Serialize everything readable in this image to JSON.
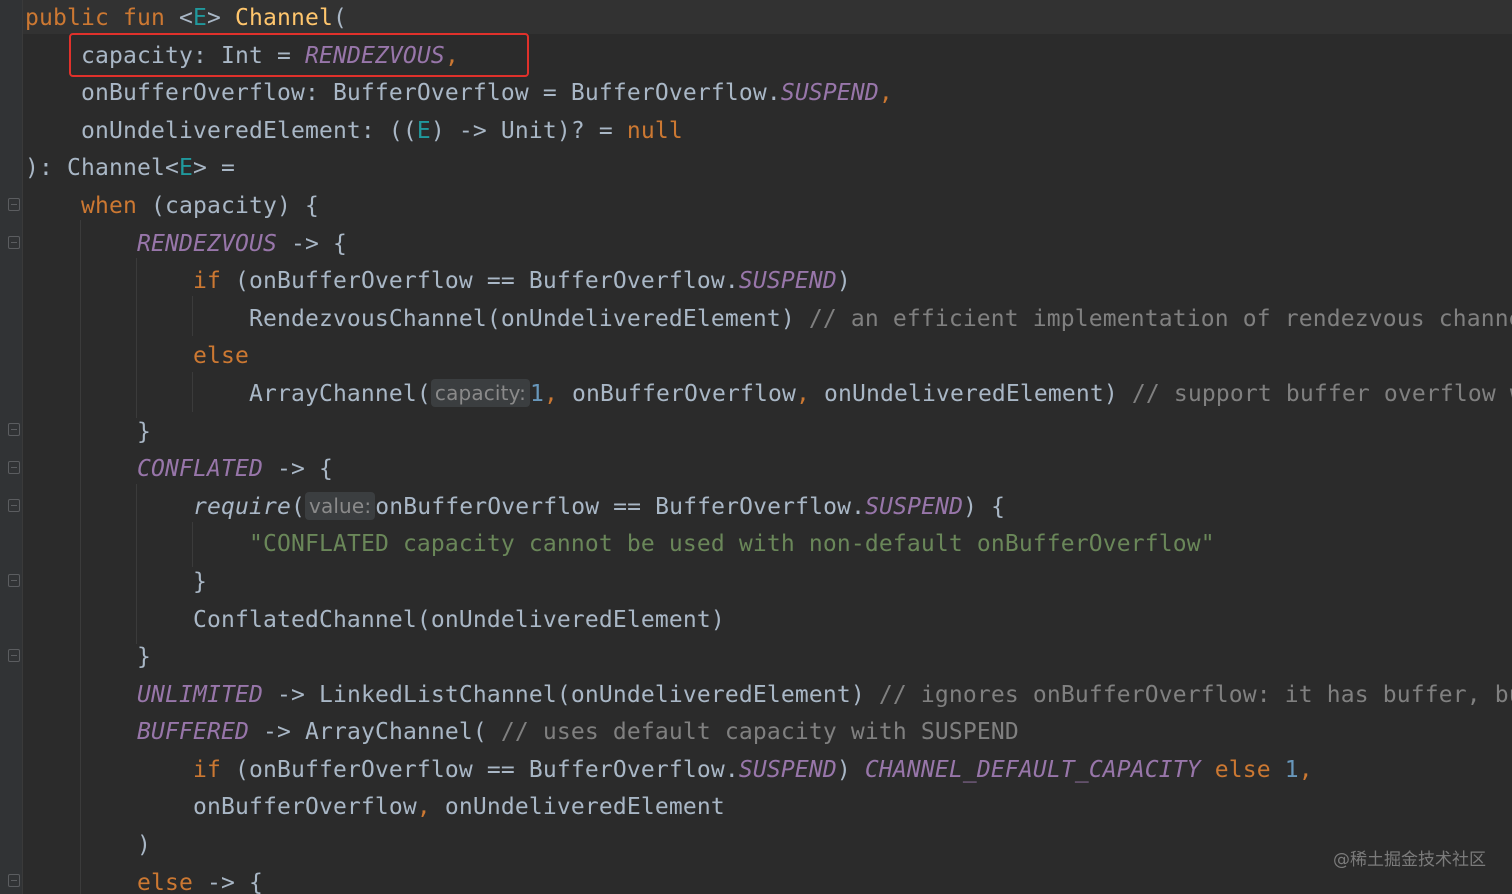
{
  "colors": {
    "background": "#2b2b2b",
    "gutter": "#313335",
    "keyword": "#cc7832",
    "function_name": "#ffc66d",
    "type_parameter": "#20999d",
    "constant": "#9876aa",
    "comment": "#808080",
    "string": "#6a8759",
    "number": "#6897bb",
    "plain": "#a9b7c6",
    "highlight_box": "#e0312b"
  },
  "editor": {
    "lines": [
      [
        {
          "t": "public fun ",
          "c": "keyword"
        },
        {
          "t": "<",
          "c": "plain"
        },
        {
          "t": "E",
          "c": "type_parameter"
        },
        {
          "t": "> ",
          "c": "plain"
        },
        {
          "t": "Channel",
          "c": "function_name"
        },
        {
          "t": "(",
          "c": "plain"
        }
      ],
      [
        {
          "t": "    capacity: Int = ",
          "c": "plain"
        },
        {
          "t": "RENDEZVOUS",
          "c": "constant",
          "i": true
        },
        {
          "t": ",",
          "c": "keyword"
        }
      ],
      [
        {
          "t": "    onBufferOverflow: BufferOverflow = BufferOverflow.",
          "c": "plain"
        },
        {
          "t": "SUSPEND",
          "c": "constant",
          "i": true
        },
        {
          "t": ",",
          "c": "keyword"
        }
      ],
      [
        {
          "t": "    onUndeliveredElement: ((",
          "c": "plain"
        },
        {
          "t": "E",
          "c": "type_parameter"
        },
        {
          "t": ") -> Unit)? = ",
          "c": "plain"
        },
        {
          "t": "null",
          "c": "keyword"
        }
      ],
      [
        {
          "t": "): Channel<",
          "c": "plain"
        },
        {
          "t": "E",
          "c": "type_parameter"
        },
        {
          "t": "> =",
          "c": "plain"
        }
      ],
      [
        {
          "t": "    ",
          "c": "plain"
        },
        {
          "t": "when",
          "c": "keyword"
        },
        {
          "t": " (capacity) {",
          "c": "plain"
        }
      ],
      [
        {
          "t": "        ",
          "c": "plain"
        },
        {
          "t": "RENDEZVOUS",
          "c": "constant",
          "i": true
        },
        {
          "t": " -> {",
          "c": "plain"
        }
      ],
      [
        {
          "t": "            ",
          "c": "plain"
        },
        {
          "t": "if",
          "c": "keyword"
        },
        {
          "t": " (onBufferOverflow == BufferOverflow.",
          "c": "plain"
        },
        {
          "t": "SUSPEND",
          "c": "constant",
          "i": true
        },
        {
          "t": ")",
          "c": "plain"
        }
      ],
      [
        {
          "t": "                RendezvousChannel(onUndeliveredElement) ",
          "c": "plain"
        },
        {
          "t": "// an efficient implementation of rendezvous channel",
          "c": "comment"
        }
      ],
      [
        {
          "t": "            ",
          "c": "plain"
        },
        {
          "t": "else",
          "c": "keyword"
        }
      ],
      [
        {
          "t": "                ArrayChannel(",
          "c": "plain"
        },
        {
          "hint": "capacity:"
        },
        {
          "t": "1",
          "c": "number"
        },
        {
          "t": ", ",
          "c": "keyword"
        },
        {
          "t": "onBufferOverflow",
          "c": "plain"
        },
        {
          "t": ", ",
          "c": "keyword"
        },
        {
          "t": "onUndeliveredElement) ",
          "c": "plain"
        },
        {
          "t": "// support buffer overflow with buffered channel",
          "c": "comment"
        }
      ],
      [
        {
          "t": "        }",
          "c": "plain"
        }
      ],
      [
        {
          "t": "        ",
          "c": "plain"
        },
        {
          "t": "CONFLATED",
          "c": "constant",
          "i": true
        },
        {
          "t": " -> {",
          "c": "plain"
        }
      ],
      [
        {
          "t": "            ",
          "c": "plain"
        },
        {
          "t": "require",
          "c": "plain",
          "i": true
        },
        {
          "t": "(",
          "c": "plain"
        },
        {
          "hint": "value:"
        },
        {
          "t": "onBufferOverflow == BufferOverflow.",
          "c": "plain"
        },
        {
          "t": "SUSPEND",
          "c": "constant",
          "i": true
        },
        {
          "t": ") {",
          "c": "plain"
        }
      ],
      [
        {
          "t": "                ",
          "c": "plain"
        },
        {
          "t": "\"CONFLATED capacity cannot be used with non-default onBufferOverflow\"",
          "c": "string"
        }
      ],
      [
        {
          "t": "            }",
          "c": "plain"
        }
      ],
      [
        {
          "t": "            ConflatedChannel(onUndeliveredElement)",
          "c": "plain"
        }
      ],
      [
        {
          "t": "        }",
          "c": "plain"
        }
      ],
      [
        {
          "t": "        ",
          "c": "plain"
        },
        {
          "t": "UNLIMITED",
          "c": "constant",
          "i": true
        },
        {
          "t": " -> LinkedListChannel(onUndeliveredElement) ",
          "c": "plain"
        },
        {
          "t": "// ignores onBufferOverflow: it has buffer, but it never overflows",
          "c": "comment"
        }
      ],
      [
        {
          "t": "        ",
          "c": "plain"
        },
        {
          "t": "BUFFERED",
          "c": "constant",
          "i": true
        },
        {
          "t": " -> ArrayChannel( ",
          "c": "plain"
        },
        {
          "t": "// uses default capacity with SUSPEND",
          "c": "comment"
        }
      ],
      [
        {
          "t": "            ",
          "c": "plain"
        },
        {
          "t": "if",
          "c": "keyword"
        },
        {
          "t": " (onBufferOverflow == BufferOverflow.",
          "c": "plain"
        },
        {
          "t": "SUSPEND",
          "c": "constant",
          "i": true
        },
        {
          "t": ") ",
          "c": "plain"
        },
        {
          "t": "CHANNEL_DEFAULT_CAPACITY",
          "c": "constant",
          "i": true
        },
        {
          "t": " ",
          "c": "plain"
        },
        {
          "t": "else",
          "c": "keyword"
        },
        {
          "t": " ",
          "c": "plain"
        },
        {
          "t": "1",
          "c": "number"
        },
        {
          "t": ",",
          "c": "keyword"
        }
      ],
      [
        {
          "t": "            onBufferOverflow",
          "c": "plain"
        },
        {
          "t": ", ",
          "c": "keyword"
        },
        {
          "t": "onUndeliveredElement",
          "c": "plain"
        }
      ],
      [
        {
          "t": "        )",
          "c": "plain"
        }
      ],
      [
        {
          "t": "        ",
          "c": "plain"
        },
        {
          "t": "else",
          "c": "keyword"
        },
        {
          "t": " -> {",
          "c": "plain"
        }
      ]
    ]
  },
  "watermark": "@稀土掘金技术社区"
}
